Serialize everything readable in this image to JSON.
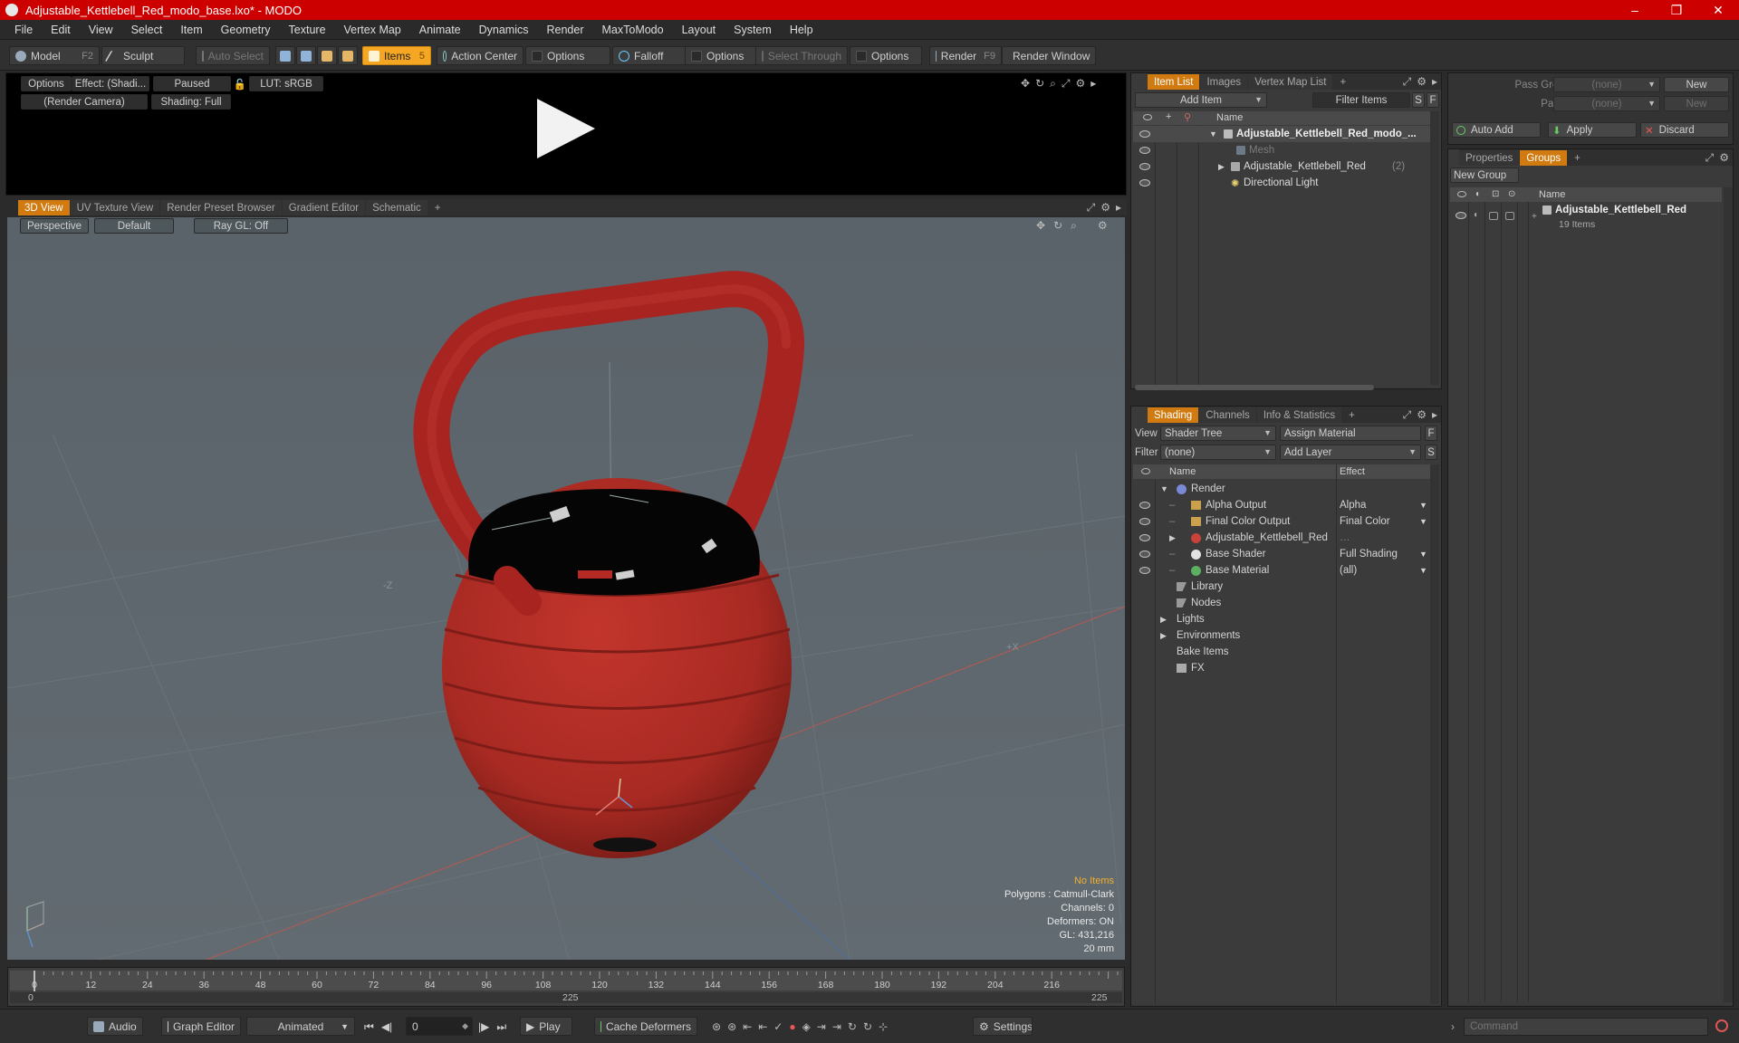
{
  "window": {
    "title": "Adjustable_Kettlebell_Red_modo_base.lxo* - MODO",
    "minimize": "–",
    "maximize": "❐",
    "close": "✕"
  },
  "menu": [
    "File",
    "Edit",
    "View",
    "Select",
    "Item",
    "Geometry",
    "Texture",
    "Vertex Map",
    "Animate",
    "Dynamics",
    "Render",
    "MaxToModo",
    "Layout",
    "System",
    "Help"
  ],
  "toolbar": {
    "model": "Model",
    "model_key": "F2",
    "sculpt": "Sculpt",
    "auto_select": "Auto Select",
    "items": "Items",
    "items_key": "5",
    "action_center": "Action Center",
    "options1": "Options",
    "falloff": "Falloff",
    "options2": "Options",
    "select_through": "Select Through",
    "options3": "Options",
    "render": "Render",
    "render_key": "F9",
    "render_window": "Render Window"
  },
  "preview": {
    "options": "Options",
    "effect": "Effect: (Shadi...",
    "paused": "Paused",
    "lut": "LUT: sRGB",
    "camera": "(Render Camera)",
    "shading": "Shading: Full"
  },
  "viewport_tabs": [
    "3D View",
    "UV Texture View",
    "Render Preset Browser",
    "Gradient Editor",
    "Schematic",
    "+"
  ],
  "viewport": {
    "perspective": "Perspective",
    "default": "Default",
    "raygl": "Ray GL: Off",
    "axis_neg_z": "-Z",
    "axis_pos_x": "+X",
    "info": {
      "no_items": "No Items",
      "polygons": "Polygons : Catmull-Clark",
      "channels": "Channels: 0",
      "deformers": "Deformers: ON",
      "gl": "GL: 431,216",
      "scale": "20 mm"
    }
  },
  "timeline": {
    "ticks": [
      "0",
      "12",
      "24",
      "36",
      "48",
      "60",
      "72",
      "84",
      "96",
      "108",
      "120",
      "132",
      "144",
      "156",
      "168",
      "180",
      "192",
      "204",
      "216"
    ],
    "sub": {
      "start": "0",
      "mid": "225",
      "end": "225"
    }
  },
  "bottom": {
    "audio": "Audio",
    "graph_editor": "Graph Editor",
    "animated": "Animated",
    "frame": "0",
    "play": "Play",
    "cache_deformers": "Cache Deformers",
    "settings": "Settings"
  },
  "item_list": {
    "tabs": [
      "Item List",
      "Images",
      "Vertex Map List",
      "+"
    ],
    "add_item": "Add Item",
    "filter_items": "Filter Items",
    "s": "S",
    "f": "F",
    "col_name": "Name",
    "rows": [
      {
        "label": "Adjustable_Kettlebell_Red_modo_...",
        "bold": true
      },
      {
        "label": "Mesh",
        "dim": true
      },
      {
        "label": "Adjustable_Kettlebell_Red",
        "count": "(2)"
      },
      {
        "label": "Directional Light"
      }
    ]
  },
  "shading": {
    "tabs": [
      "Shading",
      "Channels",
      "Info & Statistics",
      "+"
    ],
    "view_label": "View",
    "view_value": "Shader Tree",
    "assign_material": "Assign Material",
    "f": "F",
    "filter_label": "Filter",
    "filter_value": "(none)",
    "add_layer": "Add Layer",
    "s": "S",
    "col_name": "Name",
    "col_effect": "Effect",
    "rows": [
      {
        "label": "Render",
        "effect": ""
      },
      {
        "label": "Alpha Output",
        "effect": "Alpha"
      },
      {
        "label": "Final Color Output",
        "effect": "Final Color"
      },
      {
        "label": "Adjustable_Kettlebell_Red",
        "effect": ""
      },
      {
        "label": "Base Shader",
        "effect": "Full Shading"
      },
      {
        "label": "Base Material",
        "effect": "(all)"
      },
      {
        "label": "Library",
        "effect": ""
      },
      {
        "label": "Nodes",
        "effect": ""
      },
      {
        "label": "Lights",
        "effect": ""
      },
      {
        "label": "Environments",
        "effect": ""
      },
      {
        "label": "Bake Items",
        "effect": ""
      },
      {
        "label": "FX",
        "effect": ""
      }
    ]
  },
  "pass": {
    "pass_groups": "Pass Groups",
    "passes": "Passes",
    "none1": "(none)",
    "none2": "(none)",
    "new1": "New",
    "new2": "New",
    "auto_add": "Auto Add",
    "apply": "Apply",
    "discard": "Discard"
  },
  "groups": {
    "tabs": [
      "Properties",
      "Groups",
      "+"
    ],
    "new_group": "New Group",
    "col_name": "Name",
    "group_name": "Adjustable_Kettlebell_Red",
    "group_count": "19 Items"
  },
  "command": {
    "placeholder": "Command"
  },
  "colors": {
    "accent": "#d07a10",
    "title": "#cd0000",
    "kettlebell": "#b52a24",
    "handle": "#a82420"
  }
}
